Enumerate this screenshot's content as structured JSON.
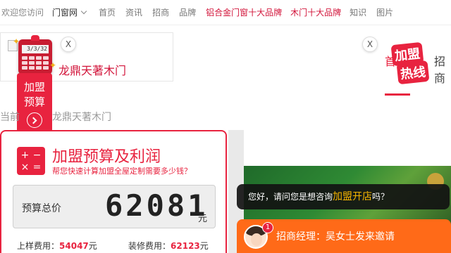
{
  "topnav": {
    "welcome": "欢迎您访问",
    "site": "门窗网",
    "items": [
      "首页",
      "资讯",
      "招商",
      "品牌"
    ],
    "hot_items": [
      "铝合金门窗十大品牌",
      "木门十大品牌"
    ],
    "items_after": [
      "知识",
      "图片"
    ]
  },
  "ad": {
    "brand_name": "龙鼎天著木门",
    "close": "X",
    "calc_screen": "3/3/32"
  },
  "budget_badge": {
    "line1": "加盟",
    "line2": "预算"
  },
  "breadcrumb": {
    "prefix": "当前",
    "current": "龙鼎天著木门"
  },
  "budget_card": {
    "icon_keys": [
      "+",
      "−",
      "×",
      "="
    ],
    "title": "加盟预算及利润",
    "subtitle": "帮您快速计算加盟全屋定制需要多少钱？",
    "total_label": "预算总价",
    "total_value": "62081",
    "total_unit": "元",
    "sample_cost_label": "上样费用：",
    "sample_cost_value": "54047",
    "sample_cost_unit": "元",
    "decor_cost_label": "装修费用：",
    "decor_cost_value": "62123",
    "decor_cost_unit": "元"
  },
  "hotline": {
    "close": "X",
    "tab_label": "首",
    "tab_label2": "招商",
    "badge_line1": "加盟",
    "badge_line2": "热线"
  },
  "chat": {
    "question_prefix": "您好，请问您是想咨询",
    "question_highlight": "加盟开店",
    "question_suffix": "吗？",
    "unread_count": "1",
    "invite_text": "招商经理：吴女士发来邀请"
  },
  "colors": {
    "brand_red": "#e8233f",
    "chat_orange": "#ff6a18",
    "highlight_yellow": "#f5b400"
  }
}
